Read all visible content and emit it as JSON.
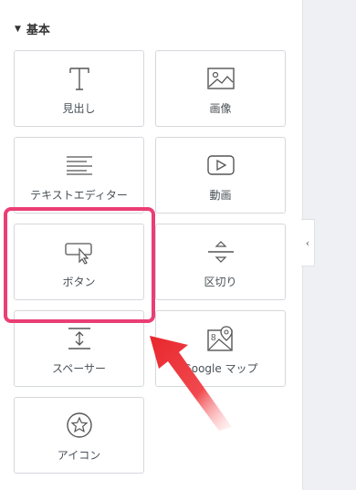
{
  "section": {
    "title": "基本"
  },
  "widgets": [
    {
      "label": "見出し",
      "icon": "heading-icon"
    },
    {
      "label": "画像",
      "icon": "image-icon"
    },
    {
      "label": "テキストエディター",
      "icon": "text-editor-icon"
    },
    {
      "label": "動画",
      "icon": "video-icon"
    },
    {
      "label": "ボタン",
      "icon": "button-icon"
    },
    {
      "label": "区切り",
      "icon": "divider-icon"
    },
    {
      "label": "スペーサー",
      "icon": "spacer-icon"
    },
    {
      "label": "Google マップ",
      "icon": "map-icon"
    },
    {
      "label": "アイコン",
      "icon": "star-icon"
    }
  ],
  "colors": {
    "highlight": "#ea3e74",
    "arrow": "#e8262c"
  }
}
